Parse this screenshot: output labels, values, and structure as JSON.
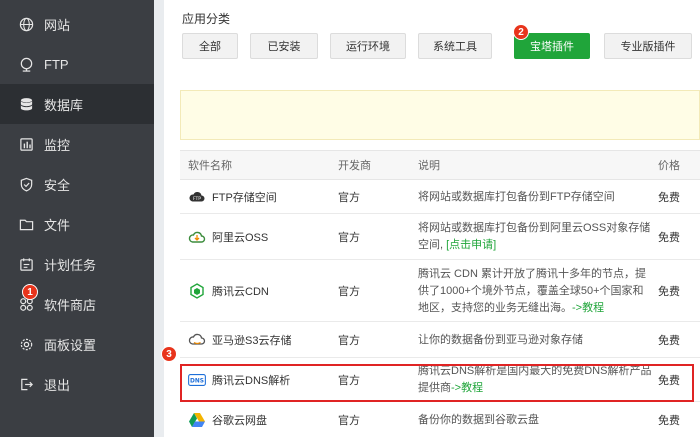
{
  "sidebar": {
    "items": [
      {
        "label": "网站",
        "icon": "globe-icon"
      },
      {
        "label": "FTP",
        "icon": "ftp-globe-icon"
      },
      {
        "label": "数据库",
        "icon": "database-icon"
      },
      {
        "label": "监控",
        "icon": "monitor-icon"
      },
      {
        "label": "安全",
        "icon": "shield-icon"
      },
      {
        "label": "文件",
        "icon": "folder-icon"
      },
      {
        "label": "计划任务",
        "icon": "calendar-icon"
      },
      {
        "label": "软件商店",
        "icon": "apps-icon"
      },
      {
        "label": "面板设置",
        "icon": "gear-icon"
      },
      {
        "label": "退出",
        "icon": "logout-icon"
      }
    ],
    "active_index": 2
  },
  "categories": {
    "title": "应用分类",
    "buttons": [
      "全部",
      "已安装",
      "运行环境",
      "系统工具",
      "宝塔插件",
      "专业版插件"
    ],
    "active_index": 4
  },
  "table": {
    "headers": [
      "软件名称",
      "开发商",
      "说明",
      "价格"
    ],
    "rows": [
      {
        "name": "FTP存储空间",
        "dev": "官方",
        "desc": "将网站或数据库打包备份到FTP存储空间",
        "link": "",
        "price": "免费",
        "icon": "ftp-cloud-icon"
      },
      {
        "name": "阿里云OSS",
        "dev": "官方",
        "desc": "将网站或数据库打包备份到阿里云OSS对象存储空间,",
        "link": "[点击申请]",
        "price": "免费",
        "icon": "aliyun-icon"
      },
      {
        "name": "腾讯云CDN",
        "dev": "官方",
        "desc": "腾讯云 CDN 累计开放了腾讯十多年的节点，提供了1000+个境外节点，覆盖全球50+个国家和地区，支持您的业务无缝出海。",
        "link": "->教程",
        "price": "免费",
        "icon": "tencent-cdn-icon"
      },
      {
        "name": "亚马逊S3云存储",
        "dev": "官方",
        "desc": "让你的数据备份到亚马逊对象存储",
        "link": "",
        "price": "免费",
        "icon": "aws-icon"
      },
      {
        "name": "腾讯云DNS解析",
        "dev": "官方",
        "desc": "腾讯云DNS解析是国内最大的免费DNS解析产品提供商",
        "link": "->教程",
        "price": "免费",
        "icon": "dns-icon"
      },
      {
        "name": "谷歌云网盘",
        "dev": "官方",
        "desc": "备份你的数据到谷歌云盘",
        "link": "",
        "price": "免费",
        "icon": "google-drive-icon"
      }
    ]
  },
  "markers": [
    "1",
    "2",
    "3"
  ],
  "colors": {
    "sidebar_bg": "#3b3e43",
    "accent": "#20a53a",
    "highlight": "#e02424"
  }
}
